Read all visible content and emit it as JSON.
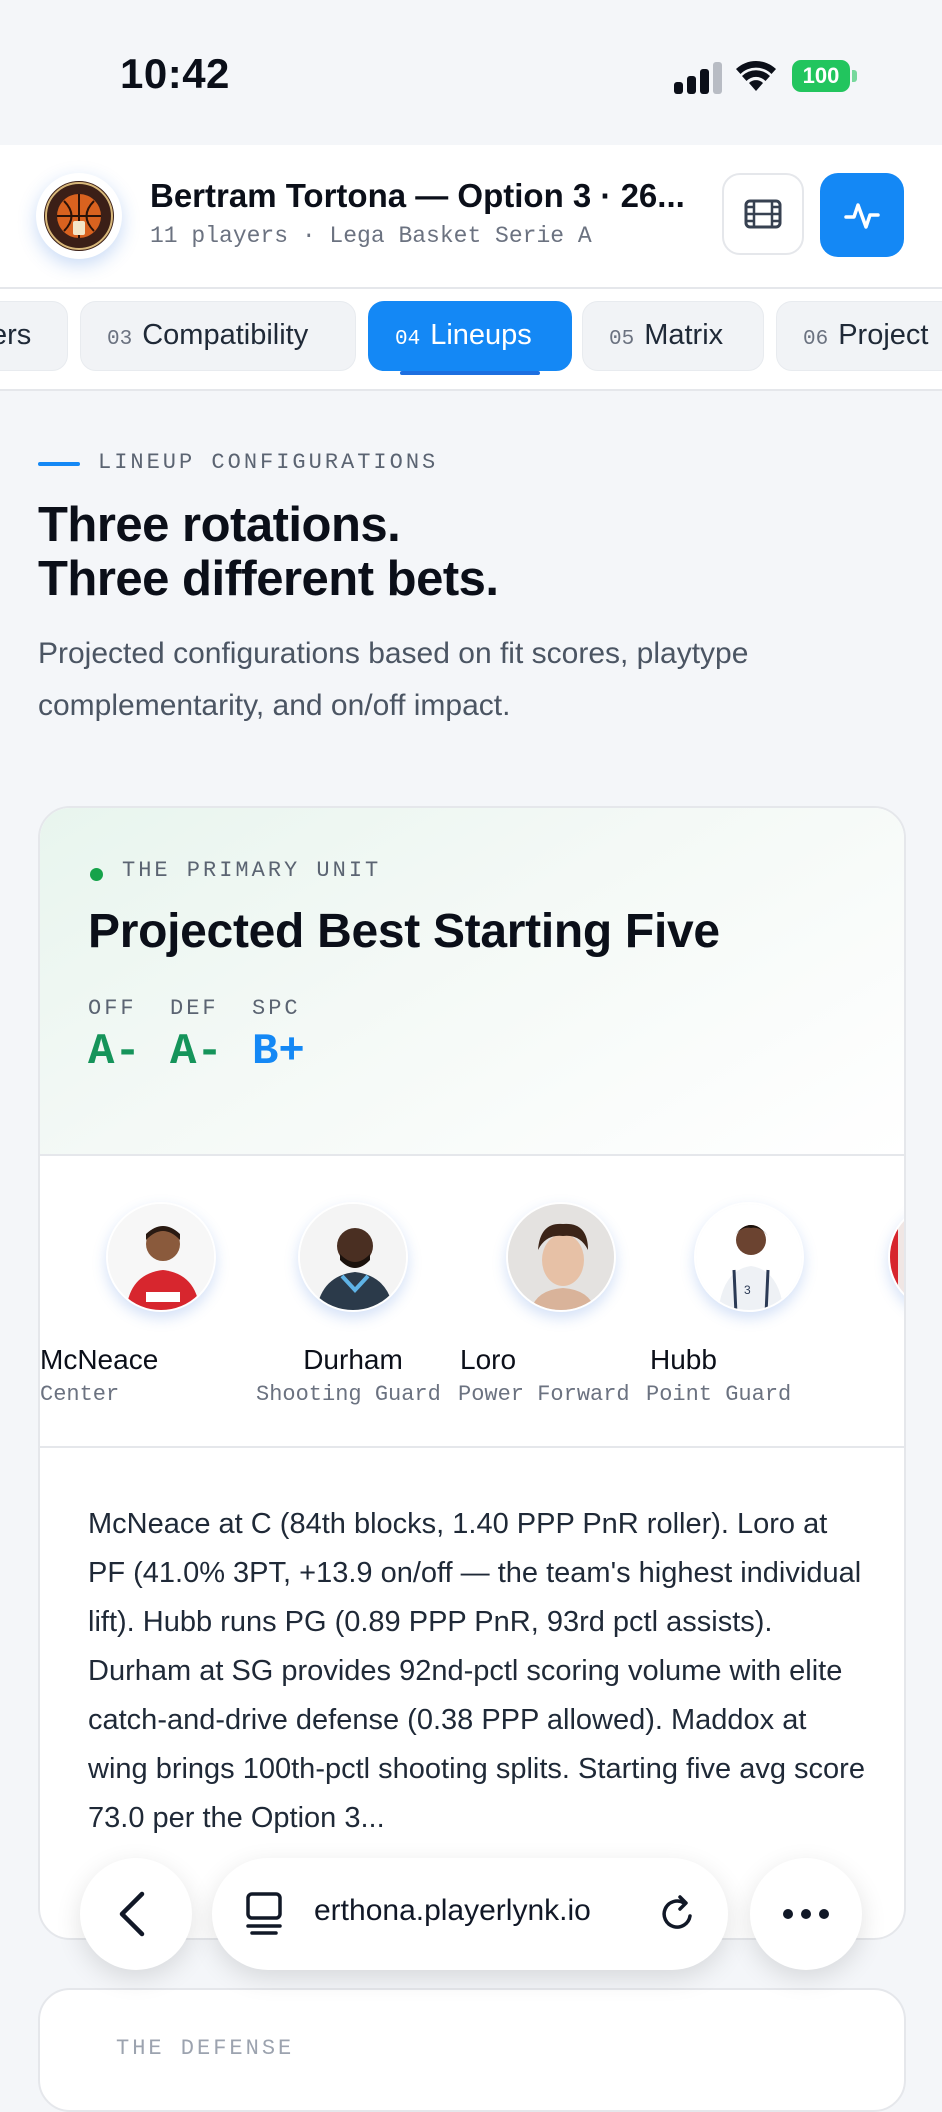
{
  "status_bar": {
    "time": "10:42",
    "battery": "100"
  },
  "header": {
    "team_title": "Bertram Tortona — Option 3 · 26...",
    "team_subtitle": "11 players · Lega Basket Serie A"
  },
  "tabs": [
    {
      "num": "",
      "label": "ers"
    },
    {
      "num": "03",
      "label": "Compatibility"
    },
    {
      "num": "04",
      "label": "Lineups",
      "active": true
    },
    {
      "num": "05",
      "label": "Matrix"
    },
    {
      "num": "06",
      "label": "Project"
    }
  ],
  "section": {
    "kicker": "LINEUP CONFIGURATIONS",
    "headline_line1": "Three rotations.",
    "headline_line2": "Three different bets.",
    "lede": "Projected configurations based on fit scores, playtype complementarity, and on/off impact."
  },
  "primary_unit": {
    "kicker": "THE PRIMARY UNIT",
    "title": "Projected Best Starting Five",
    "grades": [
      {
        "label": "OFF",
        "value": "A-",
        "color": "#15945a"
      },
      {
        "label": "DEF",
        "value": "A-",
        "color": "#15945a"
      },
      {
        "label": "SPC",
        "value": "B+",
        "color": "#1488f5"
      }
    ],
    "players": [
      {
        "name": "McNeace",
        "role": "Center"
      },
      {
        "name": "Durham",
        "role": "Shooting Guard"
      },
      {
        "name": "Loro",
        "role": "Power Forward"
      },
      {
        "name": "Hubb",
        "role": "Point Guard"
      }
    ],
    "summary": "McNeace at C (84th blocks, 1.40 PPP PnR roller). Loro at PF (41.0% 3PT, +13.9 on/off — the team's highest individual lift). Hubb runs PG (0.89 PPP PnR, 93rd pctl assists). Durham at SG provides 92nd-pctl scoring volume with elite catch-and-drive defense (0.38 PPP allowed). Maddox at wing brings 100th-pctl shooting splits. Starting five avg score 73.0 per the Option 3..."
  },
  "next_card_kicker": "THE DEFENSE",
  "browser": {
    "url": "erthona.playerlynk.io"
  },
  "colors": {
    "accent": "#1488f5",
    "grade_green": "#15945a"
  }
}
